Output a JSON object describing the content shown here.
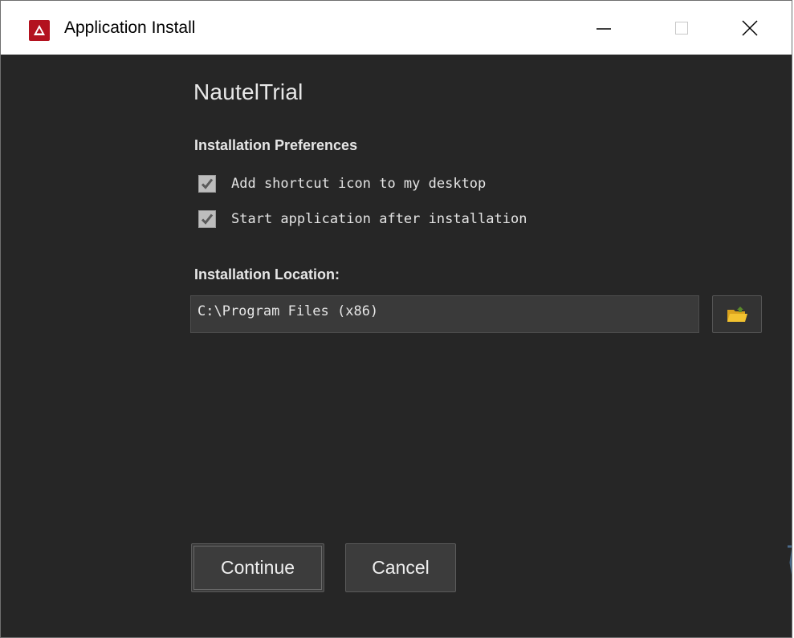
{
  "window": {
    "title": "Application Install",
    "controls": {
      "minimize_icon": "minimize-icon",
      "maximize_icon": "maximize-icon",
      "close_icon": "close-icon"
    }
  },
  "app": {
    "name": "NautelTrial"
  },
  "preferences": {
    "heading": "Installation Preferences",
    "options": [
      {
        "label": "Add shortcut icon to my desktop",
        "checked": true
      },
      {
        "label": "Start application after installation",
        "checked": true
      }
    ]
  },
  "location": {
    "heading": "Installation Location:",
    "path": "C:\\Program Files (x86)",
    "browse_icon": "folder-icon"
  },
  "actions": {
    "continue_label": "Continue",
    "cancel_label": "Cancel"
  },
  "colors": {
    "background": "#262626",
    "titlebar": "#ffffff",
    "app_icon": "#b3121f",
    "folder": "#f2c230"
  }
}
